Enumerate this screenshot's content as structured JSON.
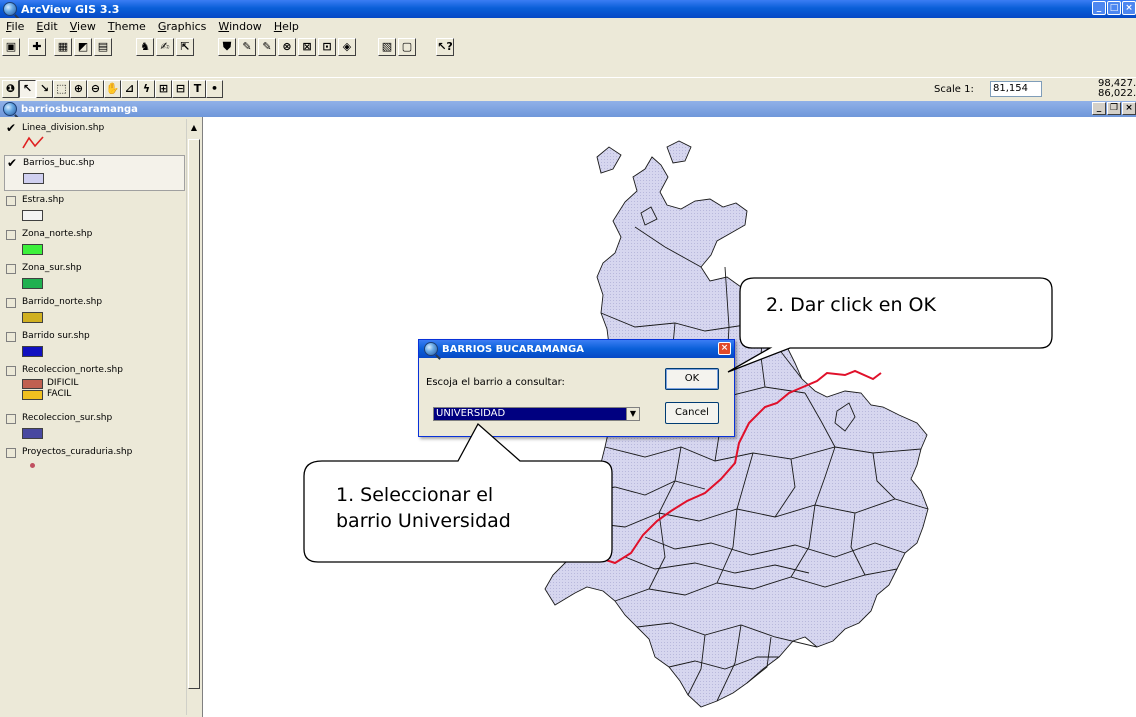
{
  "app": {
    "title": "ArcView GIS 3.3",
    "window_buttons": [
      "_",
      "□",
      "×"
    ]
  },
  "menu": [
    {
      "label": "File",
      "mnemonic": "F"
    },
    {
      "label": "Edit",
      "mnemonic": "E"
    },
    {
      "label": "View",
      "mnemonic": "V"
    },
    {
      "label": "Theme",
      "mnemonic": "T"
    },
    {
      "label": "Graphics",
      "mnemonic": "G"
    },
    {
      "label": "Window",
      "mnemonic": "W"
    },
    {
      "label": "Help",
      "mnemonic": "H"
    }
  ],
  "toolbar": {
    "scale_label": "Scale 1:",
    "scale_value": "81,154",
    "coord_x": "98,427.68",
    "coord_y": "86,022.10"
  },
  "view": {
    "title": "barriosbucaramanga"
  },
  "legend": {
    "layers": [
      {
        "name": "Linea_division.shp",
        "checked": true,
        "symbol": "line",
        "color": "#e02020"
      },
      {
        "name": "Barrios_buc.shp",
        "checked": true,
        "symbol": "fill",
        "color": "#d0d0f0",
        "selected": true
      },
      {
        "name": "Estra.shp",
        "checked": false,
        "symbol": "fill",
        "color": "#f4f4f4"
      },
      {
        "name": "Zona_norte.shp",
        "checked": false,
        "symbol": "fill",
        "color": "#3cf03c"
      },
      {
        "name": "Zona_sur.shp",
        "checked": false,
        "symbol": "fill",
        "color": "#20b050"
      },
      {
        "name": "Barrido_norte.shp",
        "checked": false,
        "symbol": "fill",
        "color": "#d0b020"
      },
      {
        "name": "Barrido sur.shp",
        "checked": false,
        "symbol": "fill",
        "color": "#1010c0"
      },
      {
        "name": "Recoleccion_norte.shp",
        "checked": false,
        "symbol": "classes",
        "classes": [
          {
            "label": "DIFICIL",
            "color": "#c06050"
          },
          {
            "label": "FACIL",
            "color": "#f0c020"
          }
        ]
      },
      {
        "name": "Recoleccion_sur.shp",
        "checked": false,
        "symbol": "fill",
        "color": "#4848a0"
      },
      {
        "name": "Proyectos_curaduria.shp",
        "checked": false,
        "symbol": "point",
        "color": "#c05060"
      }
    ]
  },
  "dialog": {
    "title": "BARRIOS BUCARAMANGA",
    "prompt": "Escoja el barrio a consultar:",
    "ok_label": "OK",
    "cancel_label": "Cancel",
    "selected_value": "UNIVERSIDAD"
  },
  "callouts": {
    "step1_line1": "1. Seleccionar el",
    "step1_line2": "barrio Universidad",
    "step2": "2. Dar click en OK"
  },
  "colors": {
    "map_fill": "#d4d4ee",
    "map_stroke": "#202020",
    "division_line": "#e0102a",
    "xp_blue": "#0a5fd8"
  }
}
